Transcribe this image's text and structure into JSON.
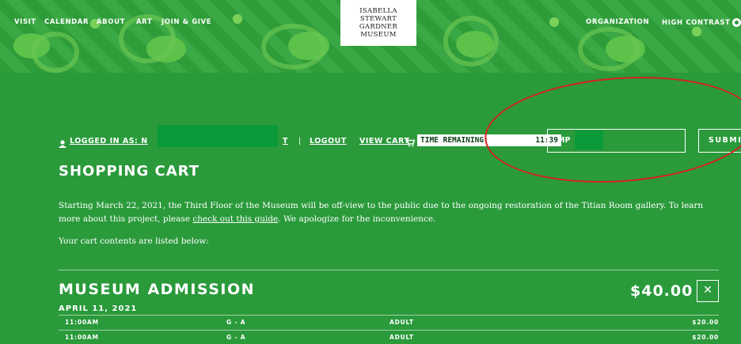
{
  "nav": {
    "left": [
      "VISIT",
      "CALENDAR",
      "ABOUT",
      "ART",
      "JOIN & GIVE"
    ],
    "right_organization": "ORGANIZATION",
    "right_contrast": "HIGH CONTRAST"
  },
  "logo": {
    "line1": "ISABELLA",
    "line2": "STEWART GARDNER",
    "line3": "MUSEUM"
  },
  "account": {
    "logged_in_label": "LOGGED IN AS: N",
    "name_tail": "T",
    "separator": "|",
    "logout": "LOGOUT",
    "view_cart": "VIEW CART",
    "time_label": "TIME REMAINING:",
    "time_value": "11:39"
  },
  "form": {
    "code_value": "MP",
    "submit_label": "SUBMIT"
  },
  "cart": {
    "title": "SHOPPING CART",
    "notice_part1": "Starting March 22, 2021, the Third Floor of the Museum will be off-view to the public due to the ongoing restoration of the Titian Room gallery. To learn more about this project, please ",
    "notice_link": "check out this guide",
    "notice_part2": ". We apologize for the inconvenience.",
    "contents_note": "Your cart contents are listed below:"
  },
  "admission": {
    "title": "MUSEUM ADMISSION",
    "total": "$40.00",
    "date": "APRIL 11, 2021",
    "rows": [
      {
        "time": "11:00AM",
        "section": "G - A",
        "type": "ADULT",
        "price": "$20.00"
      },
      {
        "time": "11:00AM",
        "section": "G - A",
        "type": "ADULT",
        "price": "$20.00"
      }
    ]
  },
  "colors": {
    "background": "#2a9a3b",
    "annotation": "#d4221c"
  }
}
